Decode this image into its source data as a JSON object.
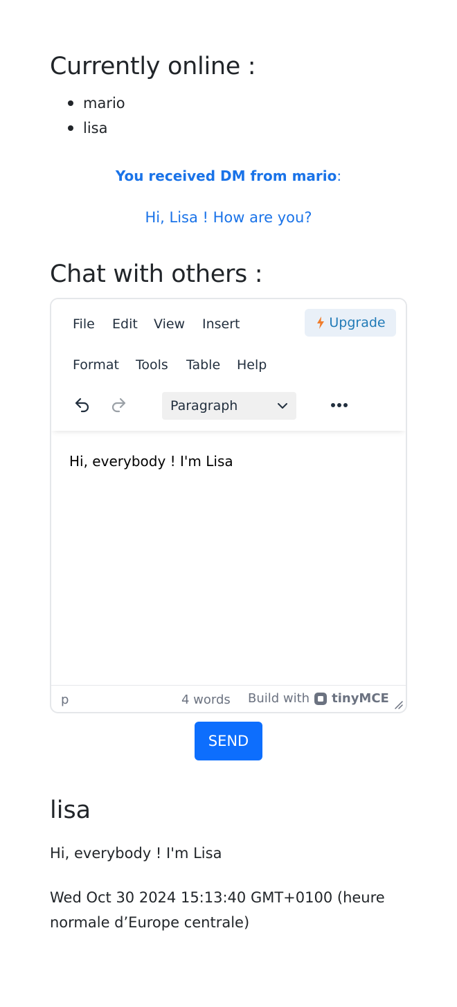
{
  "online": {
    "title": "Currently online :",
    "users": [
      "mario",
      "lisa"
    ]
  },
  "dm": {
    "notice": "You received DM from mario",
    "suffix": ":",
    "message": "Hi, Lisa ! How are you?"
  },
  "chat": {
    "title": "Chat with others :",
    "editor": {
      "menus": [
        "File",
        "Edit",
        "View",
        "Insert",
        "Format",
        "Tools",
        "Table",
        "Help"
      ],
      "upgrade_label": "Upgrade",
      "block_format": "Paragraph",
      "content": "Hi, everybody ! I'm Lisa",
      "status_path": "p",
      "word_count": "4 words",
      "build_with": "Build with",
      "brand": "tinyMCE"
    },
    "send_label": "SEND"
  },
  "message": {
    "user": "lisa",
    "text": "Hi, everybody ! I'm Lisa",
    "timestamp": "Wed Oct 30 2024 15:13:40 GMT+0100 (heure normale d’Europe centrale)"
  },
  "colors": {
    "link_blue": "#1a73e8",
    "send_blue": "#0d6efd",
    "upgrade_bg": "#e9f0f8",
    "upgrade_icon": "#f07c2b"
  }
}
